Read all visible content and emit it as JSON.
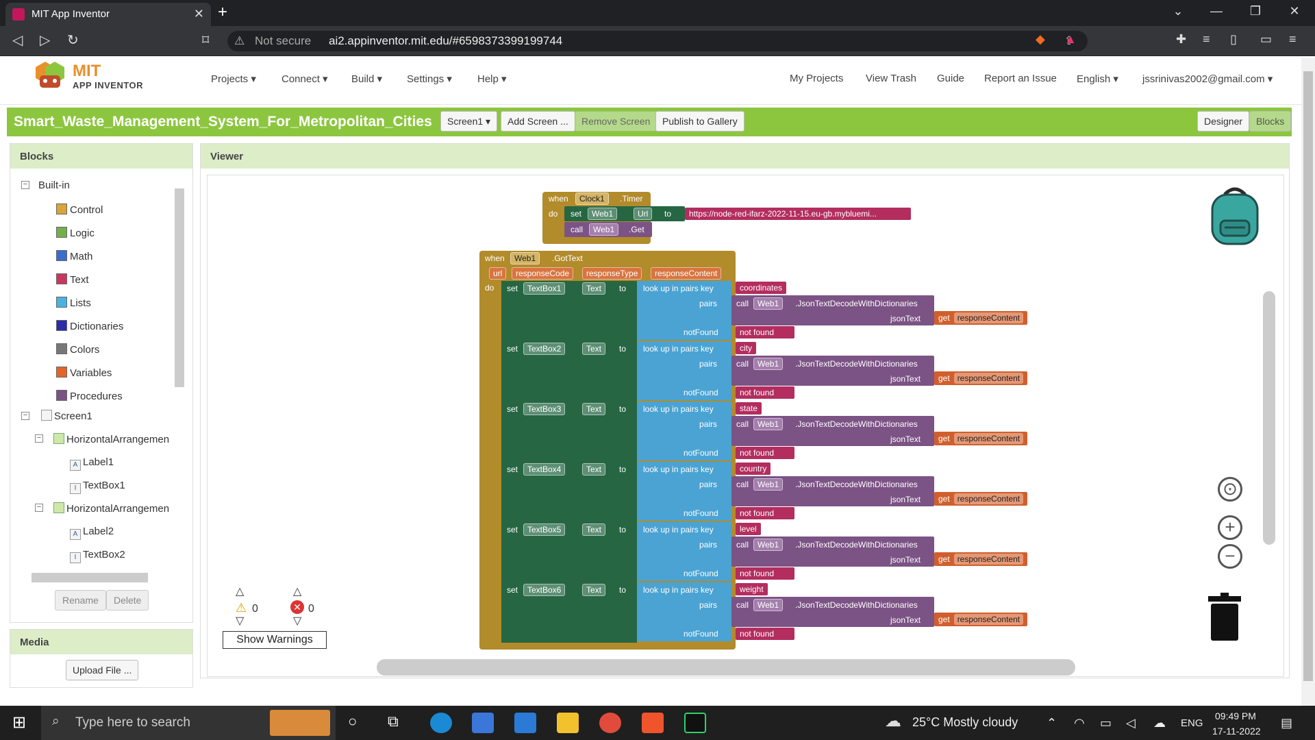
{
  "browser": {
    "tab_title": "MIT App Inventor",
    "security": "Not secure",
    "url": "ai2.appinventor.mit.edu/#6598373399199744"
  },
  "header": {
    "logo_mit": "MIT",
    "logo_sub": "APP INVENTOR",
    "menus": [
      "Projects ▾",
      "Connect ▾",
      "Build ▾",
      "Settings ▾",
      "Help ▾"
    ],
    "right_links": [
      "My Projects",
      "View Trash",
      "Guide",
      "Report an Issue",
      "English ▾",
      "jssrinivas2002@gmail.com ▾"
    ]
  },
  "toolbar": {
    "project_name": "Smart_Waste_Management_System_For_Metropolitan_Cities",
    "screen_select": "Screen1 ▾",
    "add_screen": "Add Screen ...",
    "remove_screen": "Remove Screen",
    "publish": "Publish to Gallery",
    "designer": "Designer",
    "blocks": "Blocks"
  },
  "blocks_panel": {
    "title": "Blocks",
    "builtin": "Built-in",
    "categories": [
      {
        "label": "Control",
        "color": "#d9a43a"
      },
      {
        "label": "Logic",
        "color": "#74b049"
      },
      {
        "label": "Math",
        "color": "#3c6dcc"
      },
      {
        "label": "Text",
        "color": "#c8375f"
      },
      {
        "label": "Lists",
        "color": "#4ab2df"
      },
      {
        "label": "Dictionaries",
        "color": "#2d2da8"
      },
      {
        "label": "Colors",
        "color": "#777777"
      },
      {
        "label": "Variables",
        "color": "#e2642a"
      },
      {
        "label": "Procedures",
        "color": "#7c5385"
      }
    ],
    "screen": "Screen1",
    "components": [
      "HorizontalArrangemen",
      "Label1",
      "TextBox1",
      "HorizontalArrangemen",
      "Label2",
      "TextBox2"
    ],
    "rename": "Rename",
    "delete": "Delete"
  },
  "media_panel": {
    "title": "Media",
    "upload": "Upload File ..."
  },
  "viewer": {
    "title": "Viewer",
    "timer_block": {
      "when": "when",
      "component": "Clock1",
      "event": ".Timer",
      "do": "do",
      "set": "set",
      "web": "Web1",
      "prop": "Url",
      "to": "to",
      "url": "https://node-red-ifarz-2022-11-15.eu-gb.mybluemi...",
      "call": "call",
      "method": ".Get"
    },
    "gottext_block": {
      "when": "when",
      "component": "Web1",
      "event": ".GotText",
      "params": [
        "url",
        "responseCode",
        "responseType",
        "responseContent"
      ],
      "do": "do",
      "rows": [
        {
          "textbox": "TextBox1",
          "key": "coordinates"
        },
        {
          "textbox": "TextBox2",
          "key": "city"
        },
        {
          "textbox": "TextBox3",
          "key": "state"
        },
        {
          "textbox": "TextBox4",
          "key": "country"
        },
        {
          "textbox": "TextBox5",
          "key": "level"
        },
        {
          "textbox": "TextBox6",
          "key": "weight"
        }
      ],
      "set": "set",
      "prop": "Text",
      "to": "to",
      "lookup": "look up in pairs  key",
      "pairs": "pairs",
      "notfound": "notFound",
      "call": "call",
      "web": "Web1",
      "decode": ".JsonTextDecodeWithDictionaries",
      "jsontext": "jsonText",
      "get": "get",
      "var": "responseContent",
      "nf_value": "not found"
    },
    "warnings": {
      "warn_count": "0",
      "error_count": "0",
      "button": "Show Warnings"
    }
  },
  "taskbar": {
    "search_placeholder": "Type here to search",
    "weather": "25°C  Mostly cloudy",
    "lang": "ENG",
    "time": "09:49 PM",
    "date": "17-11-2022"
  }
}
